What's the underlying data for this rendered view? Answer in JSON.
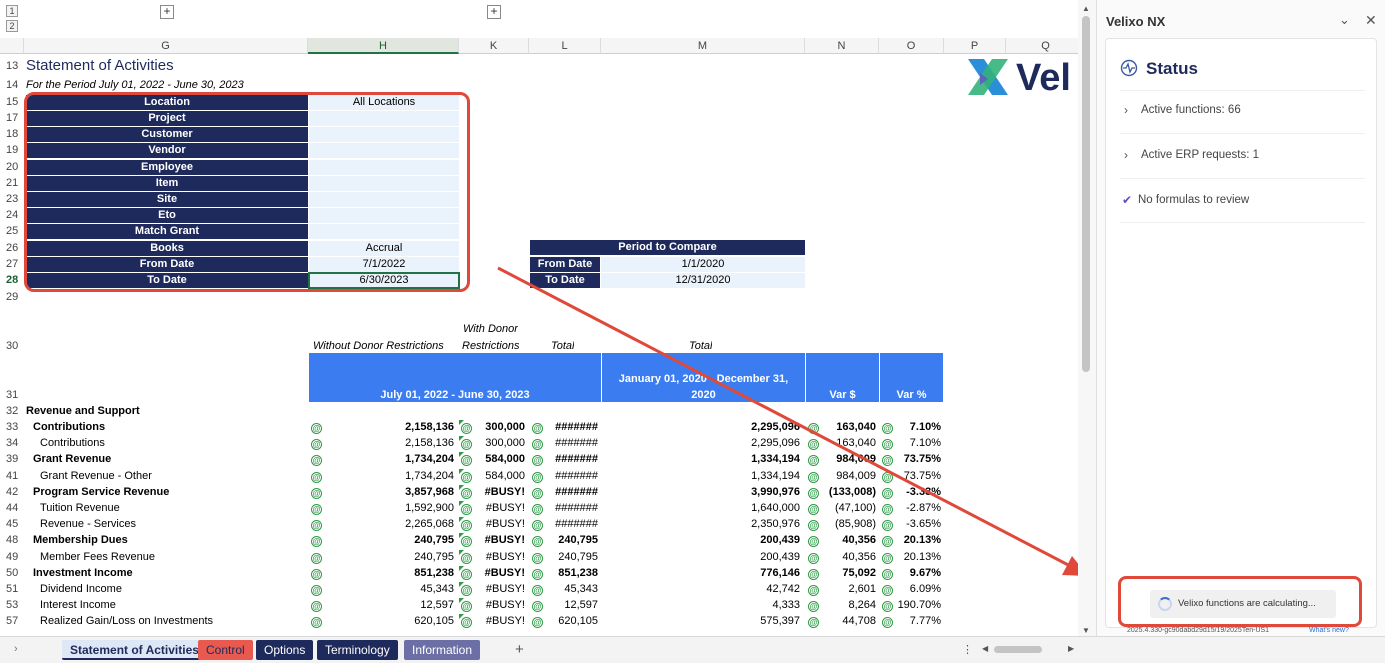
{
  "outline": {
    "level1": "1",
    "level2": "2"
  },
  "columns": [
    "G",
    "H",
    "K",
    "L",
    "M",
    "N",
    "O",
    "P",
    "Q"
  ],
  "title": "Statement of Activities",
  "subtitle": "For the Period July 01, 2022 - June 30, 2023",
  "logo_text": "Vel",
  "params": [
    {
      "row": "15",
      "label": "Location",
      "value": "All Locations"
    },
    {
      "row": "17",
      "label": "Project",
      "value": ""
    },
    {
      "row": "18",
      "label": "Customer",
      "value": ""
    },
    {
      "row": "19",
      "label": "Vendor",
      "value": ""
    },
    {
      "row": "20",
      "label": "Employee",
      "value": ""
    },
    {
      "row": "21",
      "label": "Item",
      "value": ""
    },
    {
      "row": "23",
      "label": "Site",
      "value": ""
    },
    {
      "row": "24",
      "label": "Eto",
      "value": ""
    },
    {
      "row": "25",
      "label": "Match Grant",
      "value": ""
    },
    {
      "row": "26",
      "label": "Books",
      "value": "Accrual"
    },
    {
      "row": "27",
      "label": "From Date",
      "value": "7/1/2022"
    },
    {
      "row": "28",
      "label": "To Date",
      "value": "6/30/2023"
    }
  ],
  "compare": {
    "title": "Period to Compare",
    "from_label": "From Date",
    "from": "1/1/2020",
    "to_label": "To Date",
    "to": "12/31/2020"
  },
  "row29": "29",
  "row30": "30",
  "row31": "31",
  "headers": {
    "without": "Without Donor Restrictions",
    "with_1": "With Donor",
    "with_2": "Restrictions",
    "total": "Total",
    "total2": "Total",
    "period1": "July 01, 2022 - June 30, 2023",
    "period2_1": "January 01, 2020 - December 31,",
    "period2_2": "2020",
    "var": "Var $",
    "varp": "Var %"
  },
  "rows": [
    {
      "r": "32",
      "label": "Revenue and Support",
      "bold": true,
      "indent": 0,
      "h": "",
      "k": "",
      "l": "",
      "m": "",
      "n": "",
      "o": "",
      "icons": false
    },
    {
      "r": "33",
      "label": "Contributions",
      "bold": true,
      "indent": 1,
      "h": "2,158,136",
      "k": "300,000",
      "l": "#######",
      "m": "2,295,096",
      "n": "163,040",
      "o": "7.10%",
      "icons": true
    },
    {
      "r": "34",
      "label": "Contributions",
      "bold": false,
      "indent": 2,
      "h": "2,158,136",
      "k": "300,000",
      "l": "#######",
      "m": "2,295,096",
      "n": "163,040",
      "o": "7.10%",
      "icons": true
    },
    {
      "r": "39",
      "label": "Grant Revenue",
      "bold": true,
      "indent": 1,
      "h": "1,734,204",
      "k": "584,000",
      "l": "#######",
      "m": "1,334,194",
      "n": "984,009",
      "o": "73.75%",
      "icons": true
    },
    {
      "r": "41",
      "label": "Grant Revenue - Other",
      "bold": false,
      "indent": 2,
      "h": "1,734,204",
      "k": "584,000",
      "l": "#######",
      "m": "1,334,194",
      "n": "984,009",
      "o": "73.75%",
      "icons": true
    },
    {
      "r": "42",
      "label": "Program Service Revenue",
      "bold": true,
      "indent": 1,
      "h": "3,857,968",
      "k": "#BUSY!",
      "l": "#######",
      "m": "3,990,976",
      "n": "(133,008)",
      "o": "-3.33%",
      "icons": true
    },
    {
      "r": "44",
      "label": "Tuition Revenue",
      "bold": false,
      "indent": 2,
      "h": "1,592,900",
      "k": "#BUSY!",
      "l": "#######",
      "m": "1,640,000",
      "n": "(47,100)",
      "o": "-2.87%",
      "icons": true
    },
    {
      "r": "45",
      "label": "Revenue - Services",
      "bold": false,
      "indent": 2,
      "h": "2,265,068",
      "k": "#BUSY!",
      "l": "#######",
      "m": "2,350,976",
      "n": "(85,908)",
      "o": "-3.65%",
      "icons": true
    },
    {
      "r": "48",
      "label": "Membership Dues",
      "bold": true,
      "indent": 1,
      "h": "240,795",
      "k": "#BUSY!",
      "l": "240,795",
      "m": "200,439",
      "n": "40,356",
      "o": "20.13%",
      "icons": true
    },
    {
      "r": "49",
      "label": "Member Fees Revenue",
      "bold": false,
      "indent": 2,
      "h": "240,795",
      "k": "#BUSY!",
      "l": "240,795",
      "m": "200,439",
      "n": "40,356",
      "o": "20.13%",
      "icons": true
    },
    {
      "r": "50",
      "label": "Investment Income",
      "bold": true,
      "indent": 1,
      "h": "851,238",
      "k": "#BUSY!",
      "l": "851,238",
      "m": "776,146",
      "n": "75,092",
      "o": "9.67%",
      "icons": true
    },
    {
      "r": "51",
      "label": "Dividend Income",
      "bold": false,
      "indent": 2,
      "h": "45,343",
      "k": "#BUSY!",
      "l": "45,343",
      "m": "42,742",
      "n": "2,601",
      "o": "6.09%",
      "icons": true
    },
    {
      "r": "53",
      "label": "Interest Income",
      "bold": false,
      "indent": 2,
      "h": "12,597",
      "k": "#BUSY!",
      "l": "12,597",
      "m": "4,333",
      "n": "8,264",
      "o": "190.70%",
      "icons": true
    },
    {
      "r": "57",
      "label": "Realized Gain/Loss on Investments",
      "bold": false,
      "indent": 2,
      "h": "620,105",
      "k": "#BUSY!",
      "l": "620,105",
      "m": "575,397",
      "n": "44,708",
      "o": "7.77%",
      "icons": true
    }
  ],
  "tabs": [
    {
      "label": "Statement of Activities",
      "bg": "#dde7f5",
      "fg": "#1f2a5c"
    },
    {
      "label": "Control",
      "bg": "#e85a4f",
      "fg": "#1f2a5c"
    },
    {
      "label": "Options",
      "bg": "#1f2a5c",
      "fg": "#ffffff"
    },
    {
      "label": "Terminology",
      "bg": "#1f2a5c",
      "fg": "#ffffff"
    },
    {
      "label": "Information",
      "bg": "#6b6fa6",
      "fg": "#ffffff"
    }
  ],
  "add_tab": "+",
  "panel": {
    "title": "Velixo NX",
    "status": "Status",
    "active_functions": "Active functions: 66",
    "active_erp": "Active ERP requests: 1",
    "no_formulas": "No formulas to review",
    "calculating": "Velixo functions are calculating...",
    "version": "2025.4.330-gc90dabd29d15/19/2025Ten-US1",
    "whats_new": "What's new?"
  },
  "colors": {
    "navy": "#1f2a5c",
    "blue_header": "#3b7df0",
    "annotation": "#e0493a",
    "green": "#2e9a46"
  }
}
